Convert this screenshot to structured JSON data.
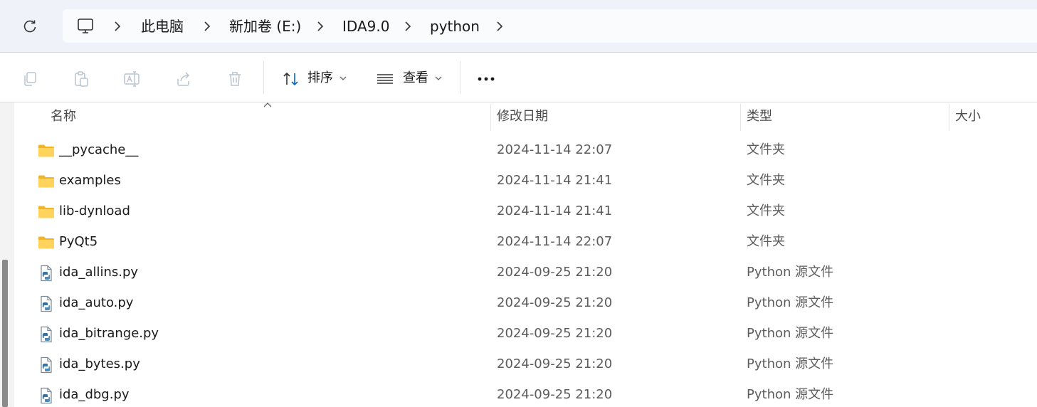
{
  "breadcrumb": {
    "items": [
      "此电脑",
      "新加卷 (E:)",
      "IDA9.0",
      "python"
    ]
  },
  "toolbar": {
    "sort_label": "排序",
    "view_label": "查看",
    "more_label": "•••"
  },
  "columns": {
    "name": "名称",
    "modified": "修改日期",
    "type": "类型",
    "size": "大小"
  },
  "files": [
    {
      "name": "__pycache__",
      "date": "2024-11-14 22:07",
      "type": "文件夹",
      "icon": "folder-icon"
    },
    {
      "name": "examples",
      "date": "2024-11-14 21:41",
      "type": "文件夹",
      "icon": "folder-icon"
    },
    {
      "name": "lib-dynload",
      "date": "2024-11-14 21:41",
      "type": "文件夹",
      "icon": "folder-icon"
    },
    {
      "name": "PyQt5",
      "date": "2024-11-14 22:07",
      "type": "文件夹",
      "icon": "folder-icon"
    },
    {
      "name": "ida_allins.py",
      "date": "2024-09-25 21:20",
      "type": "Python 源文件",
      "icon": "python-file-icon"
    },
    {
      "name": "ida_auto.py",
      "date": "2024-09-25 21:20",
      "type": "Python 源文件",
      "icon": "python-file-icon"
    },
    {
      "name": "ida_bitrange.py",
      "date": "2024-09-25 21:20",
      "type": "Python 源文件",
      "icon": "python-file-icon"
    },
    {
      "name": "ida_bytes.py",
      "date": "2024-09-25 21:20",
      "type": "Python 源文件",
      "icon": "python-file-icon"
    },
    {
      "name": "ida_dbg.py",
      "date": "2024-09-25 21:20",
      "type": "Python 源文件",
      "icon": "python-file-icon"
    }
  ],
  "colors": {
    "folder": "#f5c542",
    "accent": "#0067c0",
    "address_bg": "#eff3f9"
  }
}
